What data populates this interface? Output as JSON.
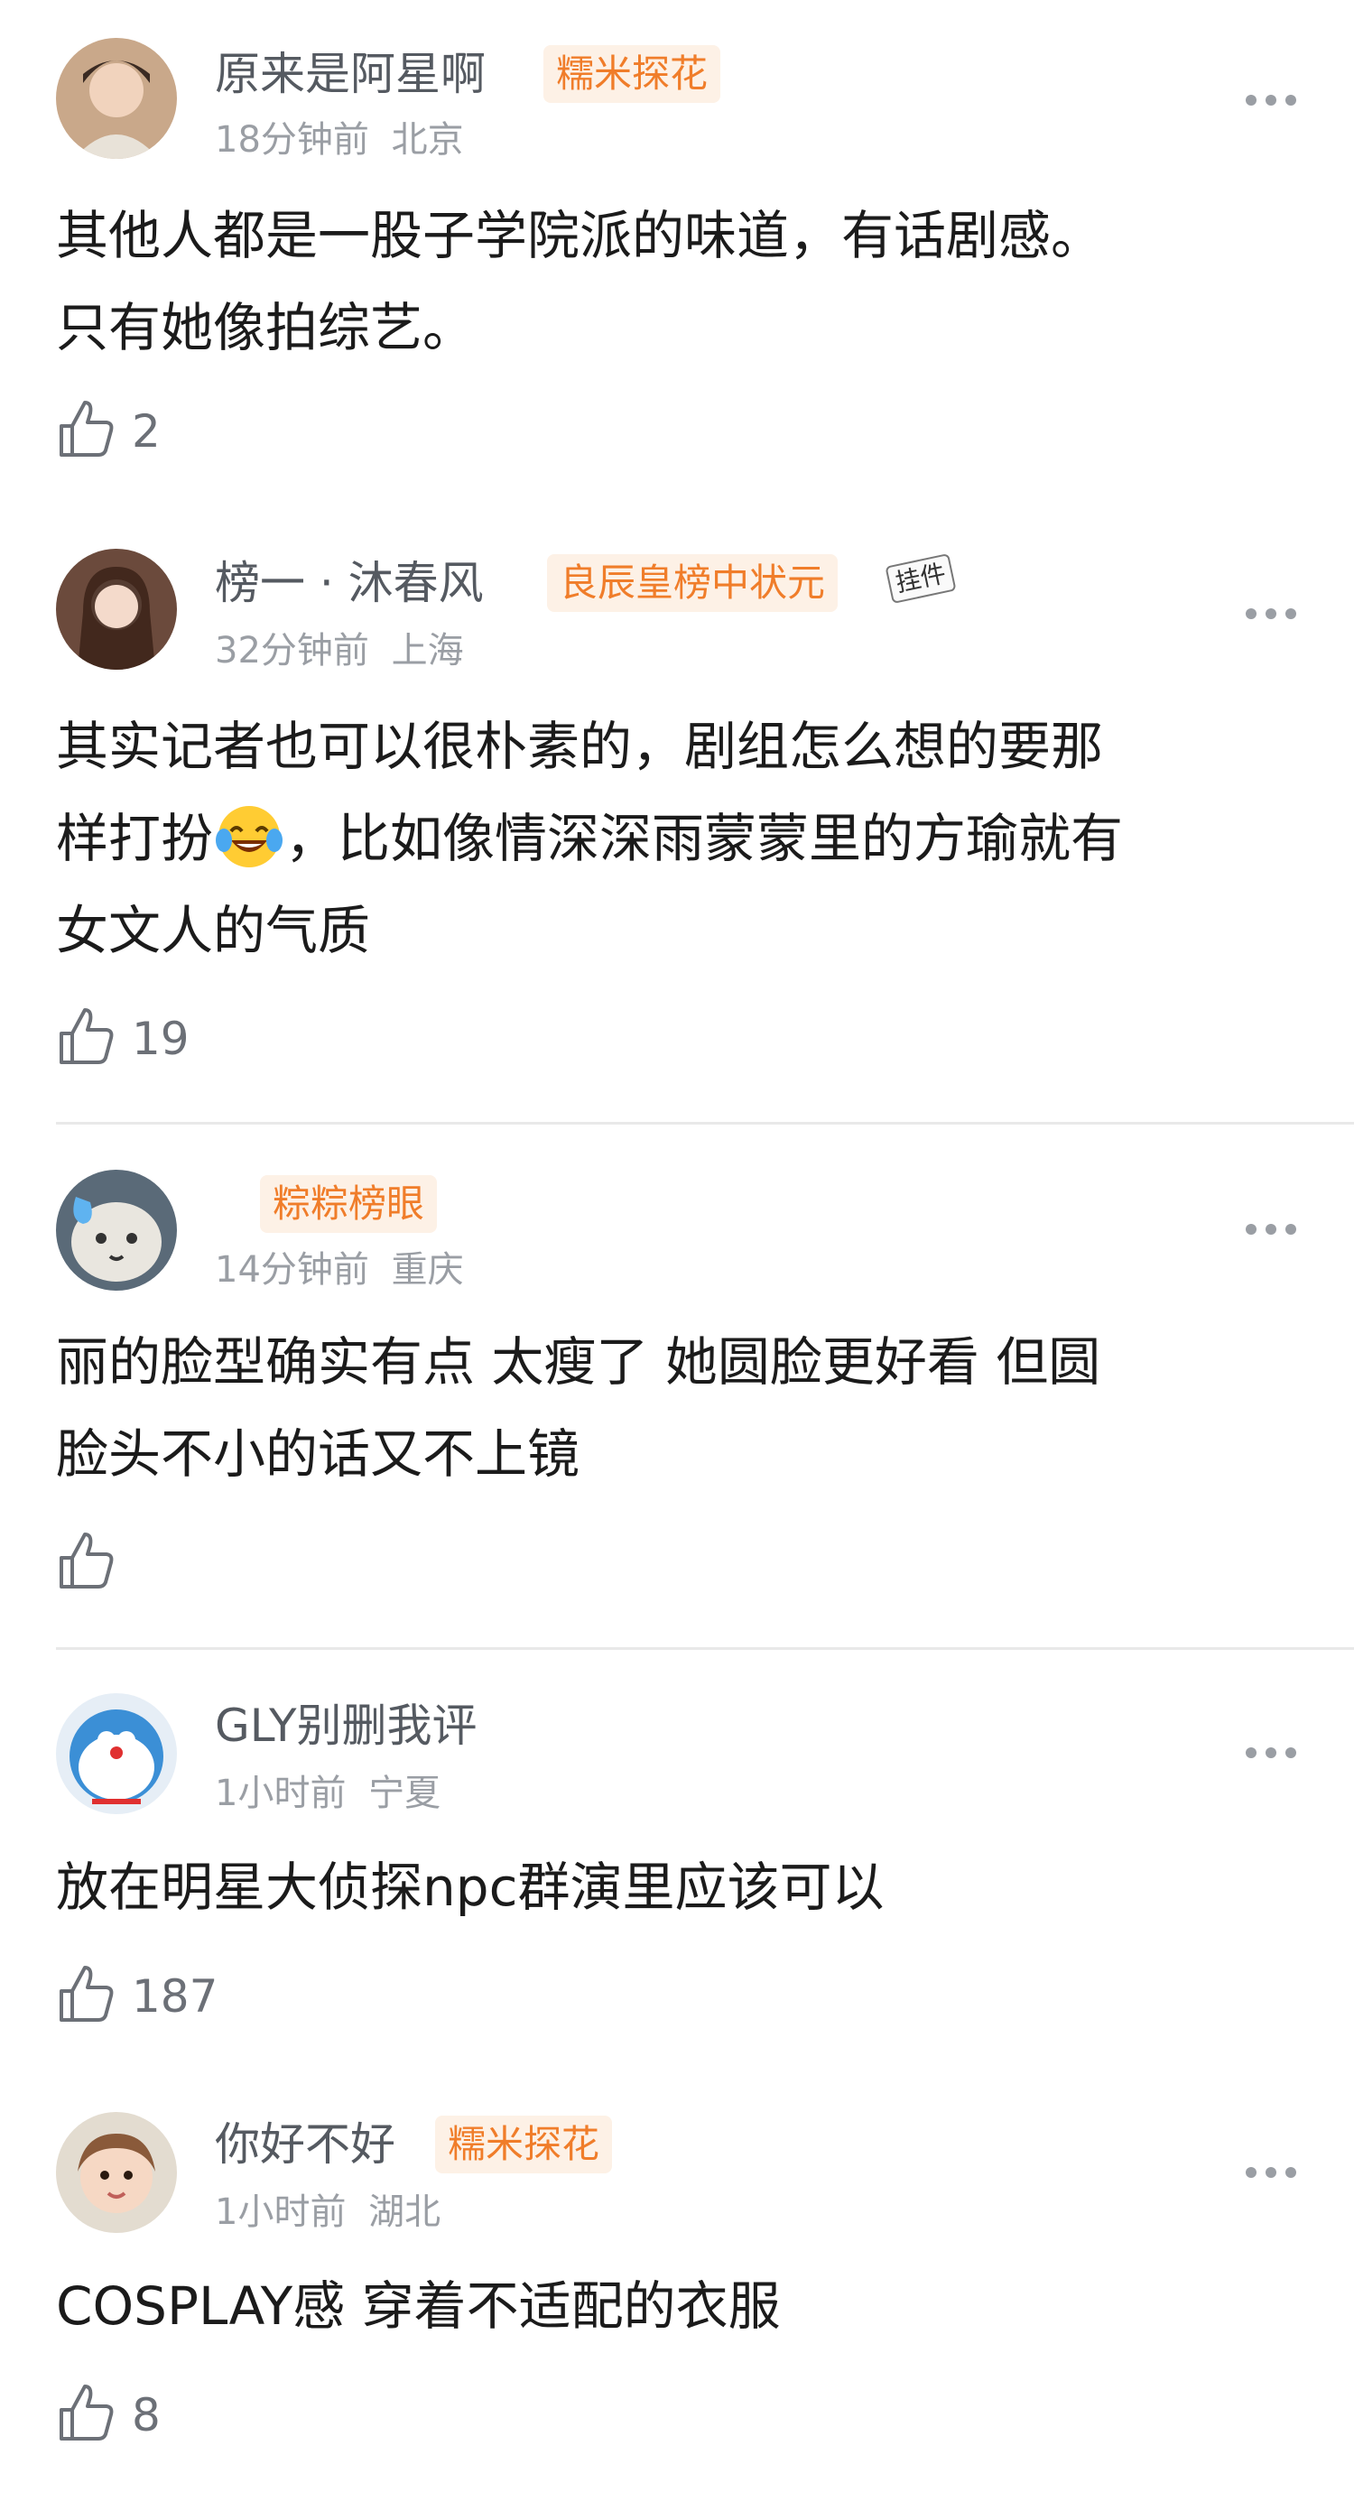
{
  "comments": [
    {
      "username": "原来是阿星啊",
      "badge": "糯米探花",
      "time": "18分钟前",
      "location": "北京",
      "text_lines": [
        "其他人都是一股子学院派的味道，有话剧感。",
        "只有她像拍综艺。"
      ],
      "likes": "2"
    },
    {
      "username": "榜一 · 沐春风",
      "badge": "良辰皇榜中状元",
      "pendant": "挂件",
      "time": "32分钟前",
      "location": "上海",
      "text_lines": [
        "其实记者也可以很朴素的，剧组怎么想的要那",
        "样打扮",
        "，比如像情深深雨蒙蒙里的方瑜就有",
        "女文人的气质"
      ],
      "emoji": "laughing-crying-emoji",
      "likes": "19"
    },
    {
      "username": "",
      "badge": "粽粽榜眼",
      "time": "14分钟前",
      "location": "重庆",
      "text_lines": [
        "丽的脸型确实有点 太瘦了 她圆脸更好看 但圆",
        "脸头不小的话又不上镜"
      ],
      "likes": ""
    },
    {
      "username": "GLY别删我评",
      "time": "1小时前",
      "location": "宁夏",
      "text_lines": [
        "放在明星大侦探npc群演里应该可以"
      ],
      "likes": "187"
    },
    {
      "username": "你好不好",
      "badge": "糯米探花",
      "time": "1小时前",
      "location": "湖北",
      "text_lines": [
        "COSPLAY感  穿着不适配的衣服"
      ],
      "likes": "8"
    }
  ],
  "icons": {
    "more": "more-dots-icon",
    "like": "thumbs-up-icon"
  },
  "colors": {
    "badge_text": "#f07d2a",
    "badge_bg": "#fdf1e6",
    "meta_text": "#9a9ea4",
    "username_text": "#555a61"
  }
}
